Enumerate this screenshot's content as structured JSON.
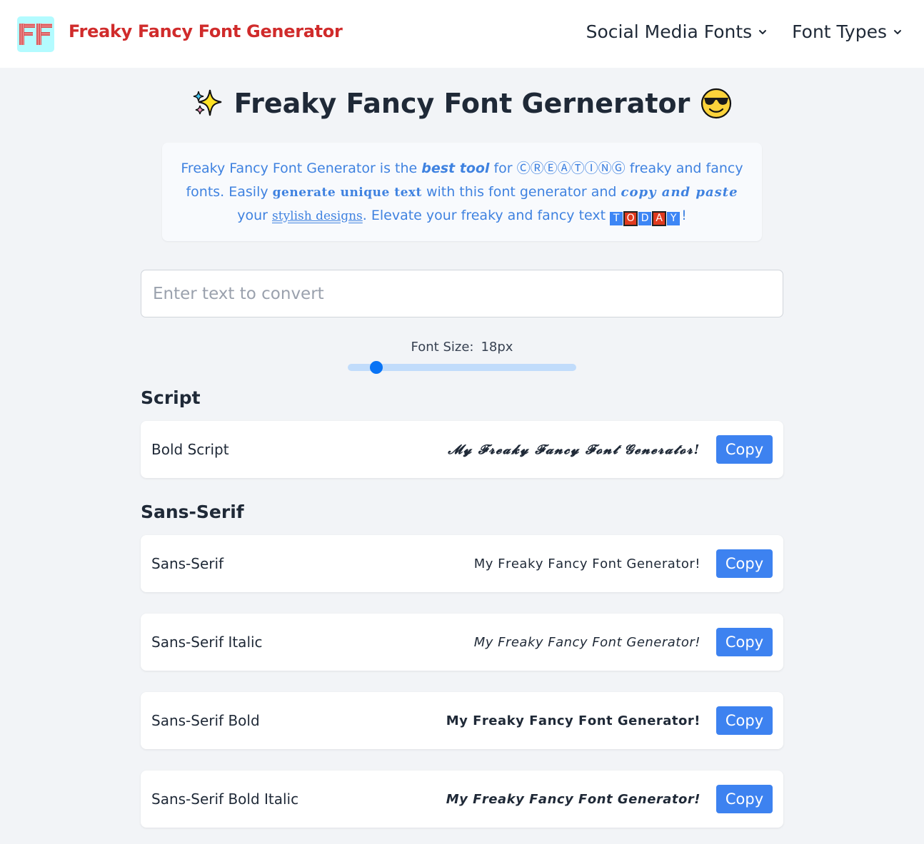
{
  "header": {
    "logo_text": "FF",
    "brand": "Freaky Fancy Font Generator",
    "nav": [
      {
        "label": "Social Media Fonts",
        "icon": "chevron-down-icon"
      },
      {
        "label": "Font Types",
        "icon": "chevron-down-icon"
      }
    ]
  },
  "title": {
    "leading_icon": "sparkles-icon",
    "text": "Freaky Fancy Font Gernerator",
    "trailing_icon": "sunglasses-face-icon"
  },
  "intro": {
    "p1": "Freaky Fancy Font Generator is the ",
    "best_tool": "best tool",
    "p2": " for ",
    "creating": "ⒸⓇⒺⒶⓉⒾⓃⒼ",
    "p3": " freaky and fancy fonts. Easily ",
    "generate_unique_text": "generate unique text",
    "p4": " with this font generator and ",
    "copy_and_paste": "copy and paste",
    "p5": " your ",
    "stylish_designs": "stylish designs",
    "p6": ". Elevate your freaky and fancy text ",
    "today": [
      "T",
      "O",
      "D",
      "A",
      "Y"
    ],
    "p7": "!"
  },
  "input": {
    "placeholder": "Enter text to convert",
    "value": ""
  },
  "slider": {
    "label": "Font Size:",
    "value_text": "18px",
    "value": 18,
    "fraction": 0.125
  },
  "sections": [
    {
      "heading": "Script",
      "rows": [
        {
          "label": "Bold Script",
          "preview": "𝓜𝔂 𝓕𝓻𝓮𝓪𝓴𝔂 𝓕𝓪𝓷𝓬𝔂 𝓕𝓸𝓷𝓽 𝓖𝓮𝓷𝓮𝓻𝓪𝓽𝓸𝓻!",
          "button": "Copy"
        }
      ]
    },
    {
      "heading": "Sans-Serif",
      "rows": [
        {
          "label": "Sans-Serif",
          "preview": "𝖬𝗒 𝖥𝗋𝖾𝖺𝗄𝗒 𝖥𝖺𝗇𝖼𝗒 𝖥𝗈𝗇𝗍 𝖦𝖾𝗇𝖾𝗋𝖺𝗍𝗈𝗋!",
          "button": "Copy"
        },
        {
          "label": "Sans-Serif Italic",
          "preview": "𝘔𝘺 𝘍𝘳𝘦𝘢𝘬𝘺 𝘍𝘢𝘯𝘤𝘺 𝘍𝘰𝘯𝘵 𝘎𝘦𝘯𝘦𝘳𝘢𝘵𝘰𝘳!",
          "button": "Copy"
        },
        {
          "label": "Sans-Serif Bold",
          "preview": "𝗠𝘆 𝗙𝗿𝗲𝗮𝗸𝘆 𝗙𝗮𝗻𝗰𝘆 𝗙𝗼𝗻𝘁 𝗚𝗲𝗻𝗲𝗿𝗮𝘁𝗼𝗿!",
          "button": "Copy"
        },
        {
          "label": "Sans-Serif Bold Italic",
          "preview": "𝙈𝙮 𝙁𝙧𝙚𝙖𝙠𝙮 𝙁𝙖𝙣𝙘𝙮 𝙁𝙤𝙣𝙩 𝙂𝙚𝙣𝙚𝙧𝙖𝙩𝙤𝙧!",
          "button": "Copy"
        }
      ]
    }
  ]
}
